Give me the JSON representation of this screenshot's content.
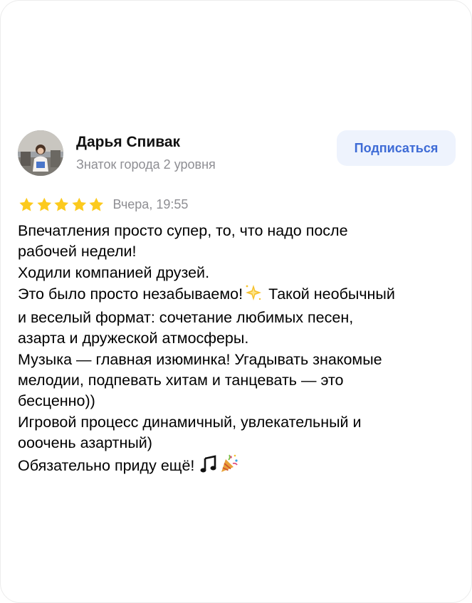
{
  "author": {
    "name": "Дарья Спивак",
    "level": "Знаток города 2 уровня"
  },
  "subscribe_label": "Подписаться",
  "rating": {
    "stars": 5,
    "max": 5,
    "date": "Вчера, 19:55"
  },
  "review": {
    "lines": [
      "Впечатления просто супер, то, что надо после",
      "рабочей недели!",
      "Ходили компанией друзей.",
      "Это было просто незабываемо!",
      "Такой необычный",
      "и веселый формат: сочетание любимых песен,",
      "азарта и дружеской атмосферы.",
      "Музыка — главная изюминка! Угадывать знакомые",
      "мелодии, подпевать хитам и танцевать  — это",
      "бесценно))",
      "Игровой процесс динамичный, увлекательный и",
      "ооочень азартный)",
      "Обязательно приду ещё!"
    ]
  },
  "icons": {
    "star": "star-icon",
    "sparkle": "glowing-star-icon",
    "music": "musical-notes-icon",
    "party": "party-popper-icon"
  },
  "colors": {
    "star": "#fcca1e",
    "subscribe_bg": "#eef3fd",
    "subscribe_text": "#3e6bd6",
    "muted_text": "#8e8e93"
  }
}
